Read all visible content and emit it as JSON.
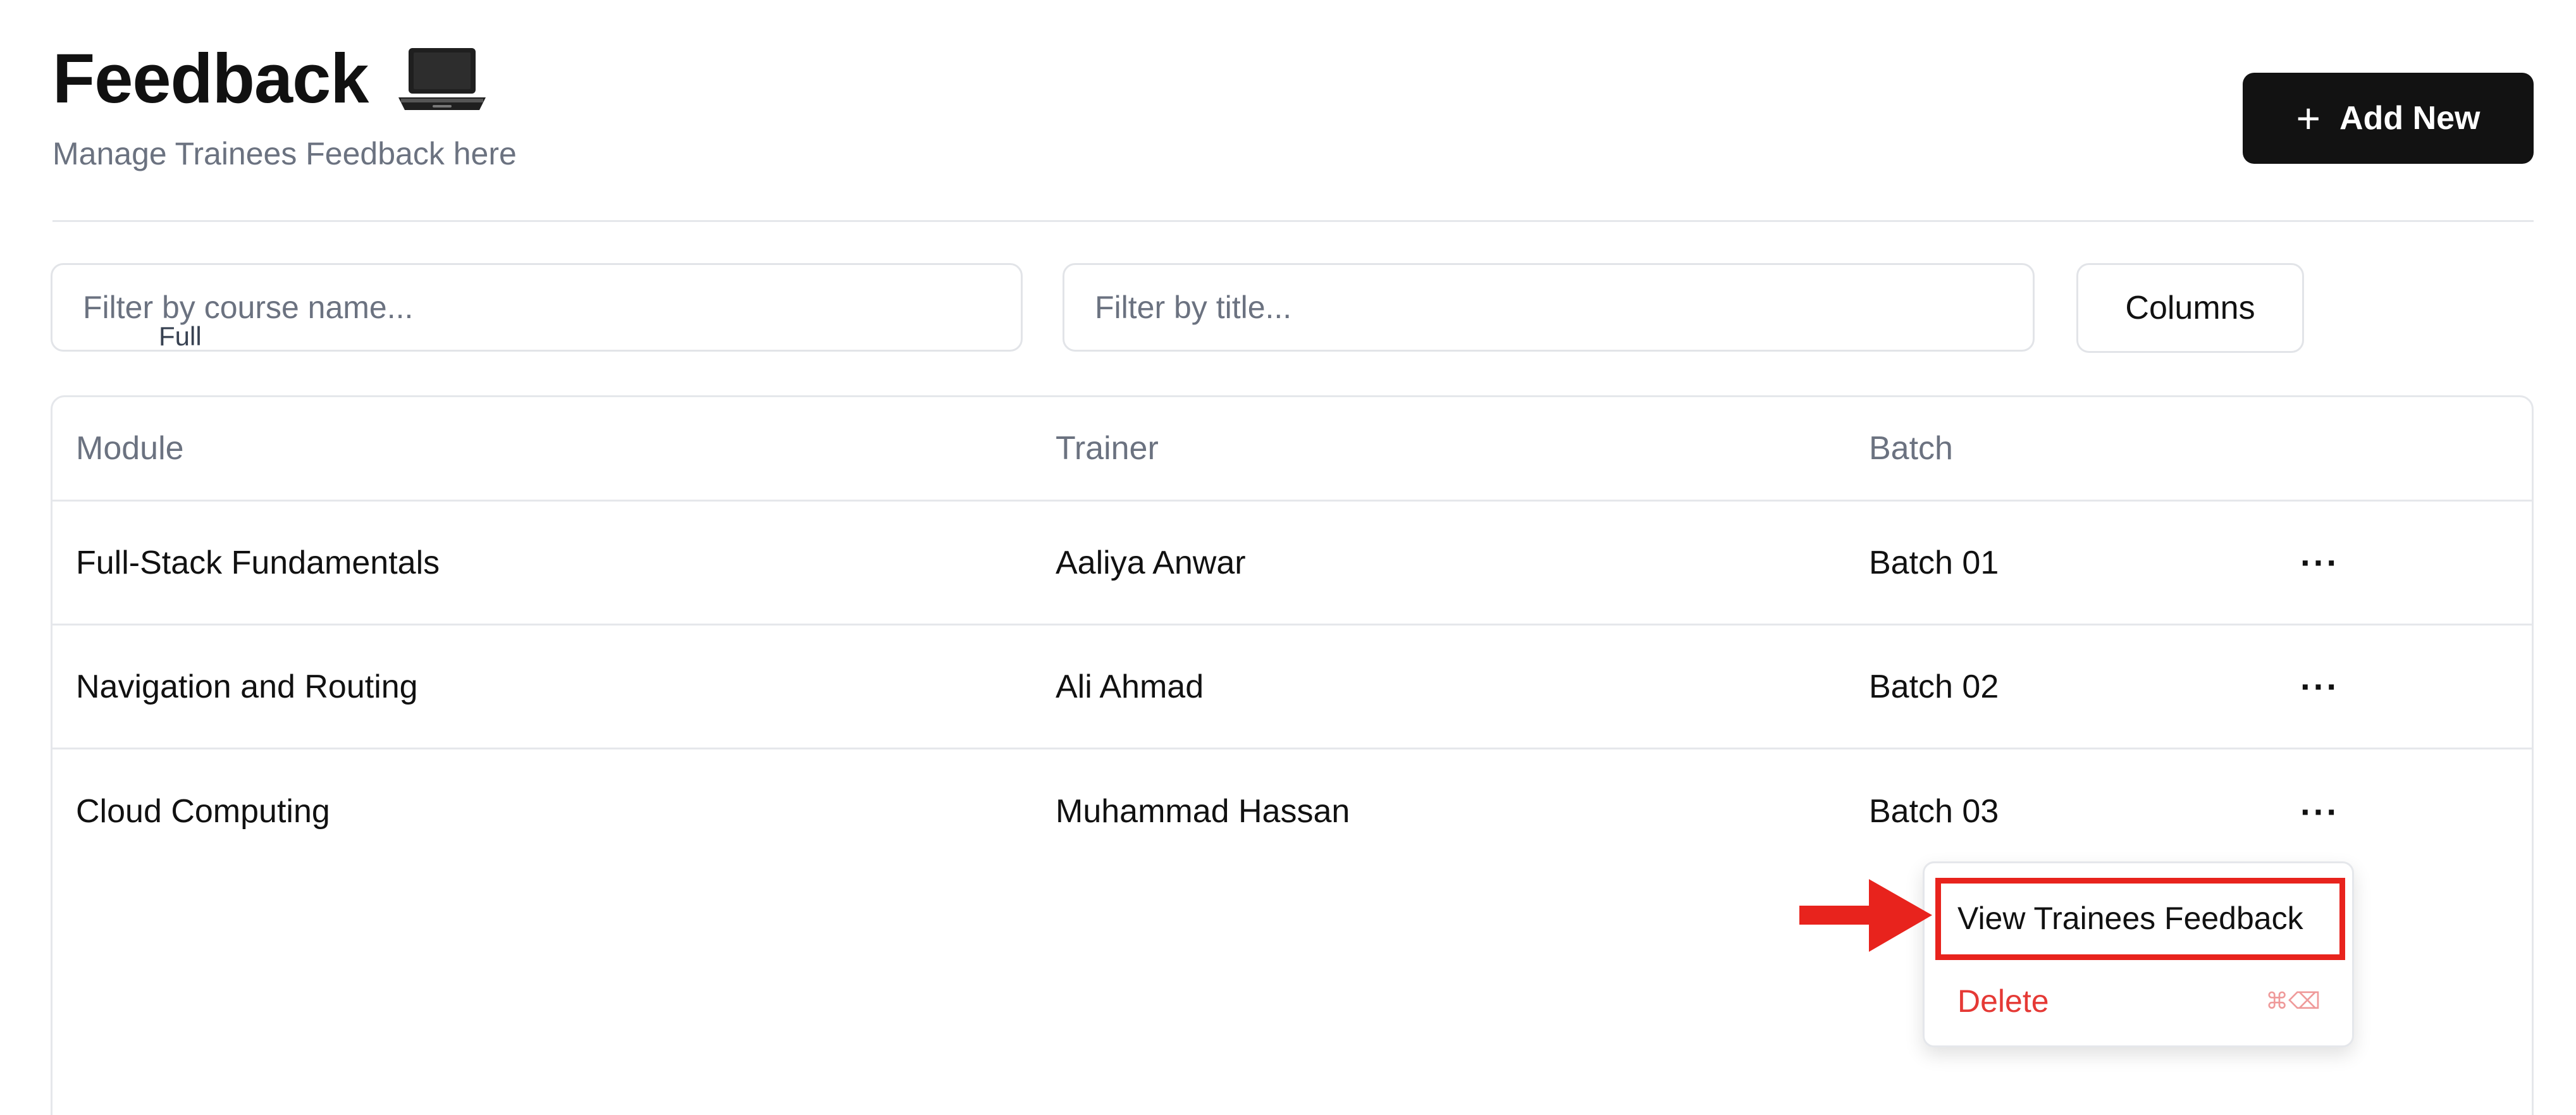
{
  "header": {
    "title": "Feedback",
    "subtitle": "Manage Trainees Feedback here",
    "title_icon": "laptop-icon",
    "add_button_label": "Add New",
    "add_button_icon": "plus-icon"
  },
  "filters": {
    "course_placeholder": "Filter by course name...",
    "course_value": "",
    "title_placeholder": "Filter by title...",
    "title_value": "",
    "stray_text": "Full",
    "columns_label": "Columns"
  },
  "table": {
    "columns": [
      "Module",
      "Trainer",
      "Batch"
    ],
    "rows": [
      {
        "module": "Full-Stack Fundamentals",
        "trainer": "Aaliya Anwar",
        "batch": "Batch 01",
        "action": "···"
      },
      {
        "module": "Navigation and Routing",
        "trainer": "Ali Ahmad",
        "batch": "Batch 02",
        "action": "···"
      },
      {
        "module": "Cloud Computing",
        "trainer": "Muhammad Hassan",
        "batch": "Batch 03",
        "action": "···"
      }
    ]
  },
  "row_menu": {
    "view_label": "View Trainees Feedback",
    "delete_label": "Delete",
    "delete_shortcut": "⌘⌫"
  },
  "annotation": {
    "highlight_color": "#e8231d",
    "arrow_icon": "red-arrow-icon"
  },
  "colors": {
    "primary_button": "#121212",
    "muted_text": "#6b7280",
    "danger": "#e53935",
    "border": "#e5e7eb"
  }
}
